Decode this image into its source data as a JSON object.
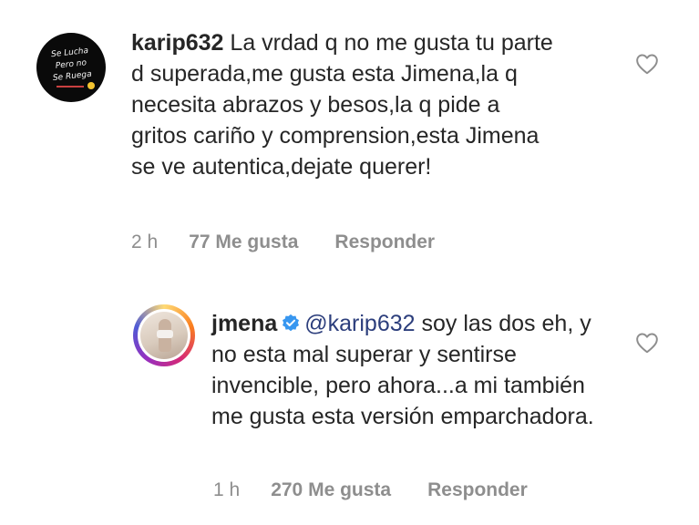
{
  "comments": [
    {
      "username": "karip632",
      "text": "La vrdad q no me gusta tu parte d superada,me gusta esta Jimena,la q necesita abrazos y besos,la q pide a gritos cariño y comprension,esta Jimena se ve autentica,dejate querer!",
      "time": "2 h",
      "likes": "77 Me gusta",
      "reply_label": "Responder",
      "avatar_text": [
        "Se Lucha",
        "Pero no",
        "Se Ruega"
      ]
    },
    {
      "username": "jmena",
      "verified": true,
      "mention": "@karip632",
      "text": "soy las dos eh, y no esta mal superar y sentirse invencible, pero ahora...a mi también me gusta esta versión emparchadora.",
      "time": "1 h",
      "likes": "270 Me gusta",
      "reply_label": "Responder"
    }
  ],
  "icons": {
    "like": "heart-outline-icon",
    "verified": "verified-badge-icon"
  },
  "colors": {
    "text": "#262626",
    "meta": "#8e8e8e",
    "verified": "#3897f0",
    "mention": "#2c3e7c"
  }
}
